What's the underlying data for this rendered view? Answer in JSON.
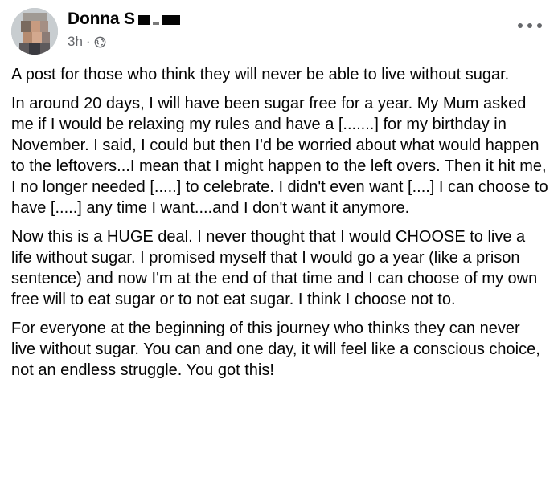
{
  "post": {
    "author": {
      "name": "Donna S",
      "name_censored": true
    },
    "meta": {
      "time": "3h",
      "separator": "·",
      "audience_icon": "globe-icon"
    },
    "more_icon": "more-options-icon",
    "paragraphs": [
      "A post for those who think they will never be able to live without sugar.",
      "In around 20 days, I will have been sugar free for a year. My Mum asked me if I would be relaxing my rules and have a [.......] for my birthday in November. I said, I could but then I'd be worried about what would happen to the leftovers...I mean that I might happen to the left overs. Then it hit me, I no longer needed [.....] to celebrate. I didn't even want [....] I can choose to have [.....] any time I want....and I don't want it anymore.",
      "Now this is a HUGE deal. I never thought that I would CHOOSE to live a life without sugar. I promised myself that I would go a year (like a prison sentence) and now I'm at the end of that time and I can choose of my own free will to eat sugar or to not eat sugar. I think I choose not to.",
      "For everyone at the beginning of this journey who thinks they can never live without sugar. You can and one day, it will feel like a conscious choice, not an endless struggle. You got this!"
    ],
    "colors": {
      "text": "#050505",
      "secondary": "#65676b",
      "background": "#ffffff"
    }
  }
}
